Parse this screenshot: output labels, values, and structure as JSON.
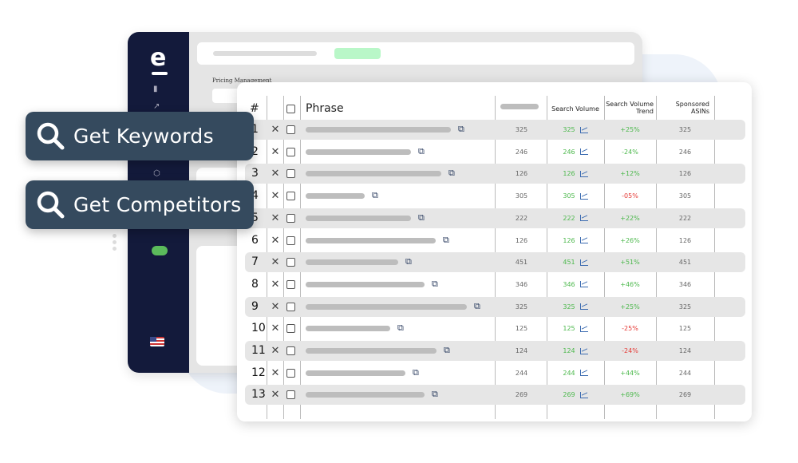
{
  "background_page": {
    "section_label": "Pricing Management",
    "sidebar_icons": [
      "logo-icon",
      "bar-chart-icon",
      "trend-icon",
      "box-icon",
      "toggle-icon",
      "us-flag-icon"
    ]
  },
  "actions": [
    {
      "label": "Get Keywords",
      "icon": "search-icon"
    },
    {
      "label": "Get Competitors",
      "icon": "search-icon"
    }
  ],
  "table": {
    "headers": {
      "num": "#",
      "phrase": "Phrase",
      "search_volume": "Search Volume",
      "trend_line1": "Search Volume",
      "trend_line2": "Trend",
      "asins_line1": "Sponsored",
      "asins_line2": "ASINs"
    },
    "colors": {
      "positive": "#4cb84c",
      "negative": "#e53935"
    },
    "rows": [
      {
        "num": "1",
        "col": "325",
        "sv": "325",
        "trend": "+25%",
        "trend_color": "green",
        "asins": "325"
      },
      {
        "num": "2",
        "col": "246",
        "sv": "246",
        "trend": "-24%",
        "trend_color": "green",
        "asins": "246"
      },
      {
        "num": "3",
        "col": "126",
        "sv": "126",
        "trend": "+12%",
        "trend_color": "green",
        "asins": "126"
      },
      {
        "num": "4",
        "col": "305",
        "sv": "305",
        "trend": "-05%",
        "trend_color": "red",
        "asins": "305"
      },
      {
        "num": "5",
        "col": "222",
        "sv": "222",
        "trend": "+22%",
        "trend_color": "green",
        "asins": "222"
      },
      {
        "num": "6",
        "col": "126",
        "sv": "126",
        "trend": "+26%",
        "trend_color": "green",
        "asins": "126"
      },
      {
        "num": "7",
        "col": "451",
        "sv": "451",
        "trend": "+51%",
        "trend_color": "green",
        "asins": "451"
      },
      {
        "num": "8",
        "col": "346",
        "sv": "346",
        "trend": "+46%",
        "trend_color": "green",
        "asins": "346"
      },
      {
        "num": "9",
        "col": "325",
        "sv": "325",
        "trend": "+25%",
        "trend_color": "green",
        "asins": "325"
      },
      {
        "num": "10",
        "col": "125",
        "sv": "125",
        "trend": "-25%",
        "trend_color": "red",
        "asins": "125"
      },
      {
        "num": "11",
        "col": "124",
        "sv": "124",
        "trend": "-24%",
        "trend_color": "red",
        "asins": "124"
      },
      {
        "num": "12",
        "col": "244",
        "sv": "244",
        "trend": "+44%",
        "trend_color": "green",
        "asins": "244"
      },
      {
        "num": "13",
        "col": "269",
        "sv": "269",
        "trend": "+69%",
        "trend_color": "green",
        "asins": "269"
      }
    ]
  }
}
